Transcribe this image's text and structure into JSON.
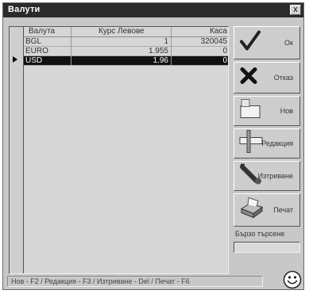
{
  "window": {
    "title": "Валути",
    "close_label": "x"
  },
  "grid": {
    "columns": [
      "Валута",
      "Курс Левове",
      "Касa"
    ],
    "rows": [
      {
        "currency": "BGL",
        "rate": "1",
        "cash": "320045",
        "selected": false
      },
      {
        "currency": "EURO",
        "rate": "1.955",
        "cash": "0",
        "selected": false
      },
      {
        "currency": "USD",
        "rate": "1.96",
        "cash": "0",
        "selected": true
      }
    ]
  },
  "buttons": {
    "ok": "Ок",
    "cancel": "Отказ",
    "new": "Нов",
    "edit": "Редакция",
    "delete": "Изтриване",
    "print": "Печат"
  },
  "sum": {
    "label": "Бързо търсене",
    "value": ""
  },
  "statusbar": {
    "text": "Нов - F2 / Редакция - F3 / Изтриване - Del / Печат - F6"
  },
  "colors": {
    "titlebar": "#2b2b2b",
    "selected_row": "#111111",
    "window_bg": "#c8c8c8"
  },
  "icons": [
    "check-icon",
    "x-icon",
    "new-doc-icon",
    "edit-icon",
    "delete-icon",
    "print-icon",
    "smiley-icon"
  ]
}
